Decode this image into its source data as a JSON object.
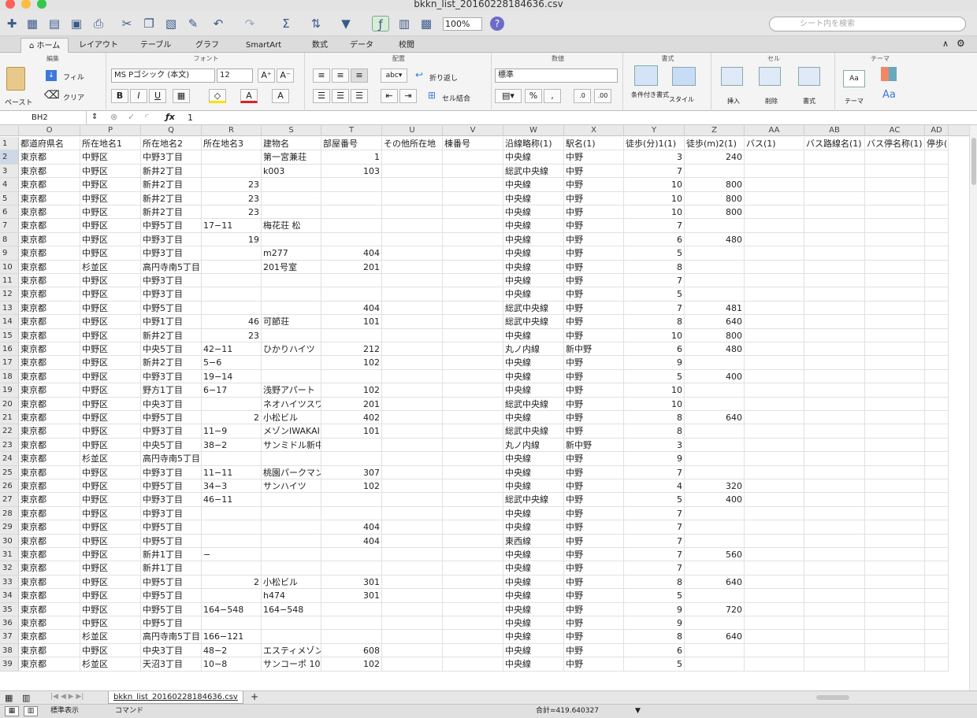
{
  "window": {
    "title": "bkkn_list_20160228184636.csv"
  },
  "toolbar": {
    "zoom": "100%",
    "search_placeholder": "シート内を検索"
  },
  "ribbon": {
    "tabs": [
      "ホーム",
      "レイアウト",
      "テーブル",
      "グラフ",
      "SmartArt",
      "数式",
      "データ",
      "校閲"
    ],
    "groups": {
      "edit": "編集",
      "font": "フォント",
      "align": "配置",
      "number": "数値",
      "format": "書式",
      "cell": "セル",
      "theme": "テーマ"
    },
    "paste": "ペースト",
    "fill": "フィル",
    "clear": "クリア",
    "font_name": "MS Pゴシック (本文)",
    "font_size": "12",
    "wrap": "折り返し",
    "merge": "セル結合",
    "number_format": "標準",
    "cond_format": "条件付き書式",
    "style": "スタイル",
    "insert": "挿入",
    "delete": "削除",
    "format_btn": "書式",
    "theme_btn": "テーマ"
  },
  "formula": {
    "cell_ref": "BH2",
    "value": "1"
  },
  "columns": [
    "O",
    "P",
    "Q",
    "R",
    "S",
    "T",
    "U",
    "V",
    "W",
    "X",
    "Y",
    "Z",
    "AA",
    "AB",
    "AC",
    "AD"
  ],
  "rows": [
    [
      "1",
      "都道府県名",
      "所在地名1",
      "所在地名2",
      "所在地名3",
      "建物名",
      "部屋番号",
      "その他所在地",
      "棟番号",
      "沿線略称(1)",
      "駅名(1)",
      "徒歩(分)1(1)",
      "徒歩(m)2(1)",
      "バス(1)",
      "バス路線名(1)",
      "バス停名称(1)",
      "停歩(分)("
    ],
    [
      "2",
      "東京都",
      "中野区",
      "中野3丁目",
      "",
      "第一宮兼荘",
      "1",
      "",
      "",
      "中央線",
      "中野",
      "3",
      "240",
      "",
      "",
      "",
      ""
    ],
    [
      "3",
      "東京都",
      "中野区",
      "新井2丁目",
      "",
      "k003",
      "103",
      "",
      "",
      "総武中央線",
      "中野",
      "7",
      "",
      "",
      "",
      "",
      ""
    ],
    [
      "4",
      "東京都",
      "中野区",
      "新井2丁目",
      "23",
      "",
      "",
      "",
      "",
      "中央線",
      "中野",
      "10",
      "800",
      "",
      "",
      "",
      ""
    ],
    [
      "5",
      "東京都",
      "中野区",
      "新井2丁目",
      "23",
      "",
      "",
      "",
      "",
      "中央線",
      "中野",
      "10",
      "800",
      "",
      "",
      "",
      ""
    ],
    [
      "6",
      "東京都",
      "中野区",
      "新井2丁目",
      "23",
      "",
      "",
      "",
      "",
      "中央線",
      "中野",
      "10",
      "800",
      "",
      "",
      "",
      ""
    ],
    [
      "7",
      "東京都",
      "中野区",
      "中野5丁目",
      "17−11",
      "梅花荘 松",
      "",
      "",
      "",
      "中央線",
      "中野",
      "7",
      "",
      "",
      "",
      "",
      ""
    ],
    [
      "8",
      "東京都",
      "中野区",
      "中野3丁目",
      "19",
      "",
      "",
      "",
      "",
      "中央線",
      "中野",
      "6",
      "480",
      "",
      "",
      "",
      ""
    ],
    [
      "9",
      "東京都",
      "中野区",
      "中野3丁目",
      "",
      "m277",
      "404",
      "",
      "",
      "中央線",
      "中野",
      "5",
      "",
      "",
      "",
      "",
      ""
    ],
    [
      "10",
      "東京都",
      "杉並区",
      "高円寺南5丁目",
      "",
      "201号室",
      "201",
      "",
      "",
      "中央線",
      "中野",
      "8",
      "",
      "",
      "",
      "",
      ""
    ],
    [
      "11",
      "東京都",
      "中野区",
      "中野3丁目",
      "",
      "",
      "",
      "",
      "",
      "中央線",
      "中野",
      "7",
      "",
      "",
      "",
      "",
      ""
    ],
    [
      "12",
      "東京都",
      "中野区",
      "中野3丁目",
      "",
      "",
      "",
      "",
      "",
      "中央線",
      "中野",
      "5",
      "",
      "",
      "",
      "",
      ""
    ],
    [
      "13",
      "東京都",
      "中野区",
      "中野5丁目",
      "",
      "",
      "404",
      "",
      "",
      "総武中央線",
      "中野",
      "7",
      "481",
      "",
      "",
      "",
      ""
    ],
    [
      "14",
      "東京都",
      "中野区",
      "中野1丁目",
      "46",
      "可節荘",
      "101",
      "",
      "",
      "総武中央線",
      "中野",
      "8",
      "640",
      "",
      "",
      "",
      ""
    ],
    [
      "15",
      "東京都",
      "中野区",
      "新井2丁目",
      "23",
      "",
      "",
      "",
      "",
      "中央線",
      "中野",
      "10",
      "800",
      "",
      "",
      "",
      ""
    ],
    [
      "16",
      "東京都",
      "中野区",
      "中央5丁目",
      "42−11",
      "ひかりハイツ",
      "212",
      "",
      "",
      "丸ノ内線",
      "新中野",
      "6",
      "480",
      "",
      "",
      "",
      ""
    ],
    [
      "17",
      "東京都",
      "中野区",
      "新井2丁目",
      "5−6",
      "",
      "102",
      "",
      "",
      "中央線",
      "中野",
      "9",
      "",
      "",
      "",
      "",
      ""
    ],
    [
      "18",
      "東京都",
      "中野区",
      "中野3丁目",
      "19−14",
      "",
      "",
      "",
      "",
      "中央線",
      "中野",
      "5",
      "400",
      "",
      "",
      "",
      ""
    ],
    [
      "19",
      "東京都",
      "中野区",
      "野方1丁目",
      "6−17",
      "浅野アパート",
      "102",
      "",
      "",
      "中央線",
      "中野",
      "10",
      "",
      "",
      "",
      "",
      ""
    ],
    [
      "20",
      "東京都",
      "中野区",
      "中央3丁目",
      "",
      "ネオハイツスワ",
      "201",
      "",
      "",
      "総武中央線",
      "中野",
      "10",
      "",
      "",
      "",
      "",
      ""
    ],
    [
      "21",
      "東京都",
      "中野区",
      "中野5丁目",
      "2",
      "小松ビル",
      "402",
      "",
      "",
      "中央線",
      "中野",
      "8",
      "640",
      "",
      "",
      "",
      ""
    ],
    [
      "22",
      "東京都",
      "中野区",
      "中野3丁目",
      "11−9",
      "メゾンIWAKAI",
      "101",
      "",
      "",
      "総武中央線",
      "中野",
      "8",
      "",
      "",
      "",
      "",
      ""
    ],
    [
      "23",
      "東京都",
      "中野区",
      "中央5丁目",
      "38−2",
      "サンミドル新中野",
      "",
      "",
      "",
      "丸ノ内線",
      "新中野",
      "3",
      "",
      "",
      "",
      "",
      ""
    ],
    [
      "24",
      "東京都",
      "杉並区",
      "高円寺南5丁目",
      "",
      "",
      "",
      "",
      "",
      "中央線",
      "中野",
      "9",
      "",
      "",
      "",
      "",
      ""
    ],
    [
      "25",
      "東京都",
      "中野区",
      "中野3丁目",
      "11−11",
      "桃園パークマン",
      "307",
      "",
      "",
      "中央線",
      "中野",
      "7",
      "",
      "",
      "",
      "",
      ""
    ],
    [
      "26",
      "東京都",
      "中野区",
      "中野5丁目",
      "34−3",
      "サンハイツ",
      "102",
      "",
      "",
      "中央線",
      "中野",
      "4",
      "320",
      "",
      "",
      "",
      ""
    ],
    [
      "27",
      "東京都",
      "中野区",
      "中野3丁目",
      "46−11",
      "",
      "",
      "",
      "",
      "総武中央線",
      "中野",
      "5",
      "400",
      "",
      "",
      "",
      ""
    ],
    [
      "28",
      "東京都",
      "中野区",
      "中野3丁目",
      "",
      "",
      "",
      "",
      "",
      "中央線",
      "中野",
      "7",
      "",
      "",
      "",
      "",
      ""
    ],
    [
      "29",
      "東京都",
      "中野区",
      "中野5丁目",
      "",
      "",
      "404",
      "",
      "",
      "中央線",
      "中野",
      "7",
      "",
      "",
      "",
      "",
      ""
    ],
    [
      "30",
      "東京都",
      "中野区",
      "中野5丁目",
      "",
      "",
      "404",
      "",
      "",
      "東西線",
      "中野",
      "7",
      "",
      "",
      "",
      "",
      ""
    ],
    [
      "31",
      "東京都",
      "中野区",
      "新井1丁目",
      "−",
      "",
      "",
      "",
      "",
      "中央線",
      "中野",
      "7",
      "560",
      "",
      "",
      "",
      ""
    ],
    [
      "32",
      "東京都",
      "中野区",
      "新井1丁目",
      "",
      "",
      "",
      "",
      "",
      "中央線",
      "中野",
      "7",
      "",
      "",
      "",
      "",
      ""
    ],
    [
      "33",
      "東京都",
      "中野区",
      "中野5丁目",
      "2",
      "小松ビル",
      "301",
      "",
      "",
      "中央線",
      "中野",
      "8",
      "640",
      "",
      "",
      "",
      ""
    ],
    [
      "34",
      "東京都",
      "中野区",
      "中野5丁目",
      "",
      "h474",
      "301",
      "",
      "",
      "中央線",
      "中野",
      "5",
      "",
      "",
      "",
      "",
      ""
    ],
    [
      "35",
      "東京都",
      "中野区",
      "中野5丁目",
      "164−548",
      "164−548",
      "",
      "",
      "",
      "中央線",
      "中野",
      "9",
      "720",
      "",
      "",
      "",
      ""
    ],
    [
      "36",
      "東京都",
      "中野区",
      "中野5丁目",
      "",
      "",
      "",
      "",
      "",
      "中央線",
      "中野",
      "9",
      "",
      "",
      "",
      "",
      ""
    ],
    [
      "37",
      "東京都",
      "杉並区",
      "高円寺南5丁目",
      "166−121",
      "",
      "",
      "",
      "",
      "中央線",
      "中野",
      "8",
      "640",
      "",
      "",
      "",
      ""
    ],
    [
      "38",
      "東京都",
      "中野区",
      "中央3丁目",
      "48−2",
      "エスティメゾン中",
      "608",
      "",
      "",
      "中央線",
      "中野",
      "6",
      "",
      "",
      "",
      "",
      ""
    ],
    [
      "39",
      "東京都",
      "杉並区",
      "天沼3丁目",
      "10−8",
      "サンコーポ 10",
      "102",
      "",
      "",
      "中央線",
      "中野",
      "5",
      "",
      "",
      "",
      "",
      ""
    ]
  ],
  "sheet": {
    "tab": "bkkn_list_20160228184636.csv"
  },
  "status": {
    "view": "標準表示",
    "mode": "コマンド",
    "sum": "合計=419.640327"
  }
}
